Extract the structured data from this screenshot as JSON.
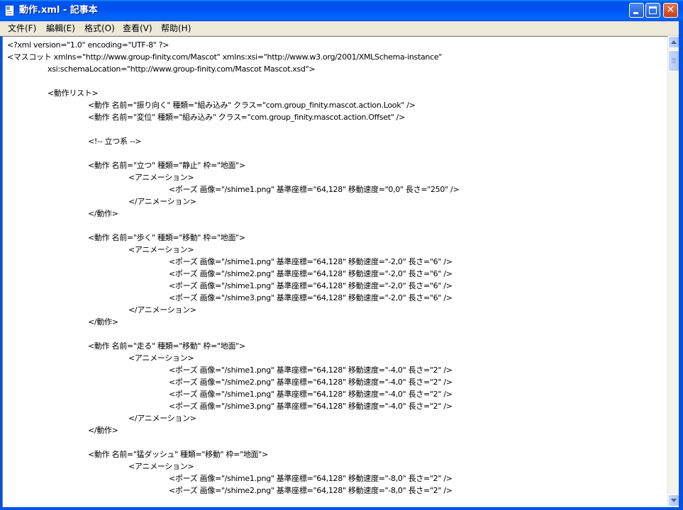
{
  "window": {
    "title": "動作.xml - 記事本",
    "icon": "notepad-icon",
    "controls": {
      "minimize": "minimize-icon",
      "maximize": "maximize-icon",
      "close_glyph": "✕"
    },
    "accent_color": "#0053ee"
  },
  "menubar": {
    "items": [
      {
        "label": "文件(F)"
      },
      {
        "label": "編輯(E)"
      },
      {
        "label": "格式(O)"
      },
      {
        "label": "查看(V)"
      },
      {
        "label": "帮助(H)"
      }
    ]
  },
  "editor": {
    "lines": [
      "<?xml version=\"1.0\" encoding=\"UTF-8\" ?>",
      "<マスコット xmlns=\"http://www.group-finity.com/Mascot\" xmlns:xsi=\"http://www.w3.org/2001/XMLSchema-instance\"",
      "\txsi:schemaLocation=\"http://www.group-finity.com/Mascot Mascot.xsd\">",
      "",
      "\t<動作リスト>",
      "\t\t<動作 名前=\"振り向く\" 種類=\"組み込み\" クラス=\"com.group_finity.mascot.action.Look\" />",
      "\t\t<動作 名前=\"変位\" 種類=\"組み込み\" クラス=\"com.group_finity.mascot.action.Offset\" />",
      "",
      "\t\t<!-- 立つ系 -->",
      "",
      "\t\t<動作 名前=\"立つ\" 種類=\"静止\" 枠=\"地面\">",
      "\t\t\t<アニメーション>",
      "\t\t\t\t<ポーズ 画像=\"/shime1.png\" 基準座標=\"64,128\" 移動速度=\"0,0\" 長さ=\"250\" />",
      "\t\t\t</アニメーション>",
      "\t\t</動作>",
      "",
      "\t\t<動作 名前=\"歩く\" 種類=\"移動\" 枠=\"地面\">",
      "\t\t\t<アニメーション>",
      "\t\t\t\t<ポーズ 画像=\"/shime1.png\" 基準座標=\"64,128\" 移動速度=\"-2,0\" 長さ=\"6\" />",
      "\t\t\t\t<ポーズ 画像=\"/shime2.png\" 基準座標=\"64,128\" 移動速度=\"-2,0\" 長さ=\"6\" />",
      "\t\t\t\t<ポーズ 画像=\"/shime1.png\" 基準座標=\"64,128\" 移動速度=\"-2,0\" 長さ=\"6\" />",
      "\t\t\t\t<ポーズ 画像=\"/shime3.png\" 基準座標=\"64,128\" 移動速度=\"-2,0\" 長さ=\"6\" />",
      "\t\t\t</アニメーション>",
      "\t\t</動作>",
      "",
      "\t\t<動作 名前=\"走る\" 種類=\"移動\" 枠=\"地面\">",
      "\t\t\t<アニメーション>",
      "\t\t\t\t<ポーズ 画像=\"/shime1.png\" 基準座標=\"64,128\" 移動速度=\"-4,0\" 長さ=\"2\" />",
      "\t\t\t\t<ポーズ 画像=\"/shime2.png\" 基準座標=\"64,128\" 移動速度=\"-4,0\" 長さ=\"2\" />",
      "\t\t\t\t<ポーズ 画像=\"/shime1.png\" 基準座標=\"64,128\" 移動速度=\"-4,0\" 長さ=\"2\" />",
      "\t\t\t\t<ポーズ 画像=\"/shime3.png\" 基準座標=\"64,128\" 移動速度=\"-4,0\" 長さ=\"2\" />",
      "\t\t\t</アニメーション>",
      "\t\t</動作>",
      "",
      "\t\t<動作 名前=\"猛ダッシュ\" 種類=\"移動\" 枠=\"地面\">",
      "\t\t\t<アニメーション>",
      "\t\t\t\t<ポーズ 画像=\"/shime1.png\" 基準座標=\"64,128\" 移動速度=\"-8,0\" 長さ=\"2\" />",
      "\t\t\t\t<ポーズ 画像=\"/shime2.png\" 基準座標=\"64,128\" 移動速度=\"-8,0\" 長さ=\"2\" />"
    ]
  },
  "scrollbar": {
    "up_icon": "scroll-up-arrow-icon",
    "down_icon": "scroll-down-arrow-icon",
    "position_fraction": 0.0
  }
}
